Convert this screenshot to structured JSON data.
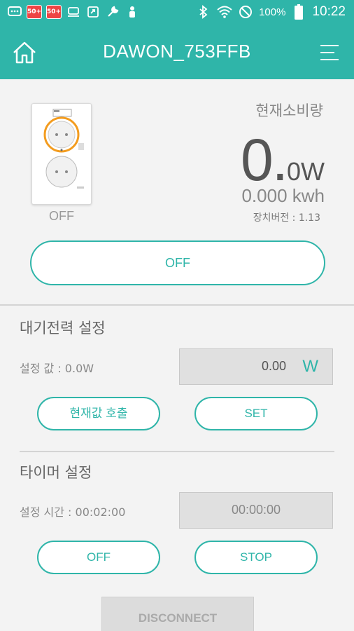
{
  "status_bar": {
    "badges": [
      "50+",
      "50+"
    ],
    "battery": "100%",
    "time": "10:22"
  },
  "app_bar": {
    "title": "DAWON_753FFB",
    "home_icon": "home-icon",
    "menu_icon": "menu-icon"
  },
  "device": {
    "state": "OFF"
  },
  "power": {
    "label": "현재소비량",
    "value_big": "0.",
    "value_small": "0W",
    "energy": "0.000 kwh",
    "firmware": "장치버전 : 1.13"
  },
  "main_toggle": {
    "label": "OFF"
  },
  "standby": {
    "title": "대기전력 설정",
    "set_value_label": "설정 값 : 0.0W",
    "input_value": "0.00",
    "unit": "W",
    "load_button": "현재값 호출",
    "set_button": "SET"
  },
  "timer": {
    "title": "타이머 설정",
    "set_time_label": "설정 시간 : 00:02:00",
    "input_value": "00:00:00",
    "off_button": "OFF",
    "stop_button": "STOP"
  },
  "footer": {
    "disconnect_button": "DISCONNECT"
  },
  "colors": {
    "accent": "#2fb5a9",
    "background": "#f3f3f3"
  }
}
